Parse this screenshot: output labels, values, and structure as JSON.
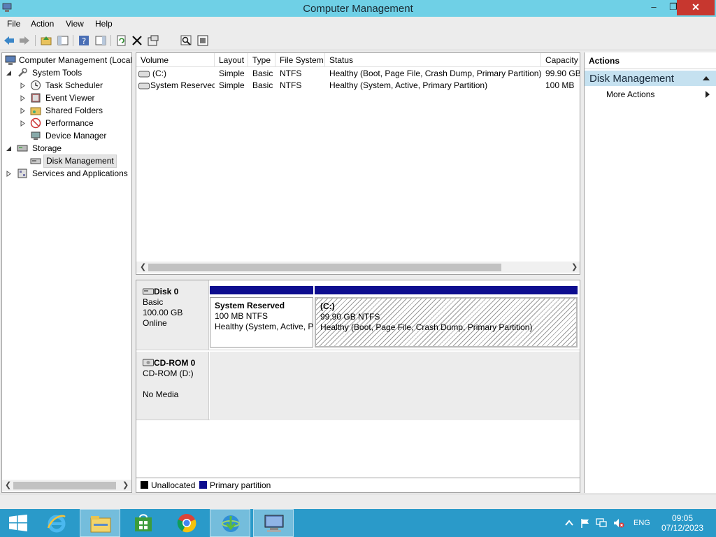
{
  "window": {
    "title": "Computer Management",
    "minimize": "–",
    "restore": "❐",
    "close": "✕"
  },
  "menu": [
    "File",
    "Action",
    "View",
    "Help"
  ],
  "toolbar": [
    "back-icon",
    "forward-icon",
    "up-folder-icon",
    "show-hide-tree-icon",
    "help-icon",
    "show-hide-action-pane-icon",
    "refresh-icon",
    "delete-icon",
    "properties-icon",
    "search-icon",
    "export-icon"
  ],
  "tree": {
    "root": "Computer Management (Local",
    "system_tools": "System Tools",
    "task_scheduler": "Task Scheduler",
    "event_viewer": "Event Viewer",
    "shared_folders": "Shared Folders",
    "performance": "Performance",
    "device_manager": "Device Manager",
    "storage": "Storage",
    "disk_management": "Disk Management",
    "services_apps": "Services and Applications"
  },
  "volumes": {
    "columns": [
      "Volume",
      "Layout",
      "Type",
      "File System",
      "Status",
      "Capacity"
    ],
    "rows": [
      [
        "(C:)",
        "Simple",
        "Basic",
        "NTFS",
        "Healthy (Boot, Page File, Crash Dump, Primary Partition)",
        "99.90 GB"
      ],
      [
        "System Reserved",
        "Simple",
        "Basic",
        "NTFS",
        "Healthy (System, Active, Primary Partition)",
        "100 MB"
      ]
    ]
  },
  "disks": {
    "disk0": {
      "name": "Disk 0",
      "type": "Basic",
      "size": "100.00 GB",
      "state": "Online",
      "partitions": [
        {
          "name": "System Reserved",
          "size": "100 MB NTFS",
          "status": "Healthy (System, Active, P"
        },
        {
          "name": "(C:)",
          "size": "99.90 GB NTFS",
          "status": "Healthy (Boot, Page File, Crash Dump, Primary Partition)"
        }
      ]
    },
    "cdrom0": {
      "name": "CD-ROM 0",
      "drive": "CD-ROM (D:)",
      "media": "No Media"
    }
  },
  "legend": {
    "unallocated": "Unallocated",
    "primary": "Primary partition",
    "unallocated_color": "#000000",
    "primary_color": "#0d0d8f"
  },
  "actions": {
    "header": "Actions",
    "section": "Disk Management",
    "more": "More Actions"
  },
  "taskbar": {
    "apps": [
      "start-icon",
      "internet-explorer-icon",
      "file-explorer-icon",
      "store-icon",
      "chrome-icon",
      "internet-download-manager-icon",
      "computer-management-icon"
    ],
    "lang": "ENG",
    "time": "09:05",
    "date": "07/12/2023"
  }
}
